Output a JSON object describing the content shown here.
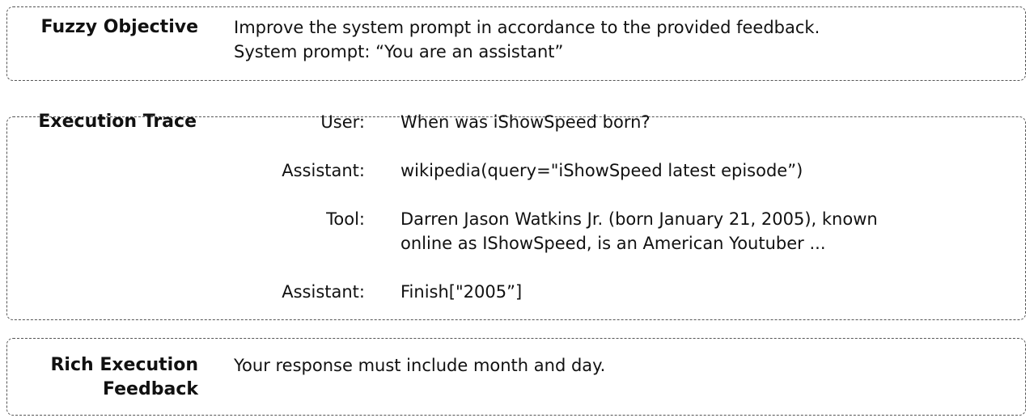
{
  "objective": {
    "label": "Fuzzy Objective",
    "line1": "Improve the system prompt in accordance to the provided feedback.",
    "line2": "System prompt: “You are an assistant”"
  },
  "trace": {
    "label": "Execution Trace",
    "turns": [
      {
        "role": "User:",
        "lines": [
          "When was iShowSpeed born?"
        ]
      },
      {
        "role": "Assistant:",
        "lines": [
          "wikipedia(query=\"iShowSpeed latest episode”)"
        ]
      },
      {
        "role": "Tool:",
        "lines": [
          "Darren Jason Watkins Jr. (born January 21, 2005), known",
          "online as IShowSpeed, is an American Youtuber ..."
        ]
      },
      {
        "role": "Assistant:",
        "lines": [
          "Finish[\"2005”]"
        ]
      }
    ]
  },
  "feedback": {
    "label_line1": "Rich Execution",
    "label_line2": "Feedback",
    "text": "Your response must include month and day."
  }
}
